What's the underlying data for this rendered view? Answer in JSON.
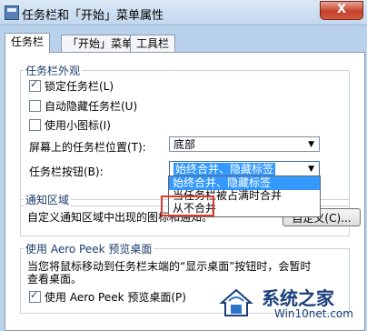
{
  "window": {
    "title": "任务栏和「开始」菜单属性",
    "close": "X"
  },
  "tabs": [
    "任务栏",
    "「开始」菜单",
    "工具栏"
  ],
  "appearance": {
    "title": "任务栏外观",
    "lock": "锁定任务栏(L)",
    "autohide": "自动隐藏任务栏(U)",
    "small_icons": "使用小图标(I)",
    "position_label": "屏幕上的任务栏位置(T):",
    "position_value": "底部",
    "buttons_label": "任务栏按钮(B):",
    "buttons_value": "始终合并、隐藏标签"
  },
  "dropdown": {
    "options": [
      "始终合并、隐藏标签",
      "当任务栏被占满时合并",
      "从不合并"
    ]
  },
  "notify": {
    "title": "通知区域",
    "desc": "自定义通知区域中出现的图标和通知。",
    "button": "自定义(C)..."
  },
  "aero": {
    "title": "使用 Aero Peek 预览桌面",
    "desc1": "当您将鼠标移动到任务栏末端的“显示桌面”按钮时，会暂时",
    "desc2": "查看桌面。",
    "checkbox": "使用 Aero Peek 预览桌面(P)"
  },
  "watermark": {
    "main": "系统之家",
    "sub": "Win10net.com"
  }
}
